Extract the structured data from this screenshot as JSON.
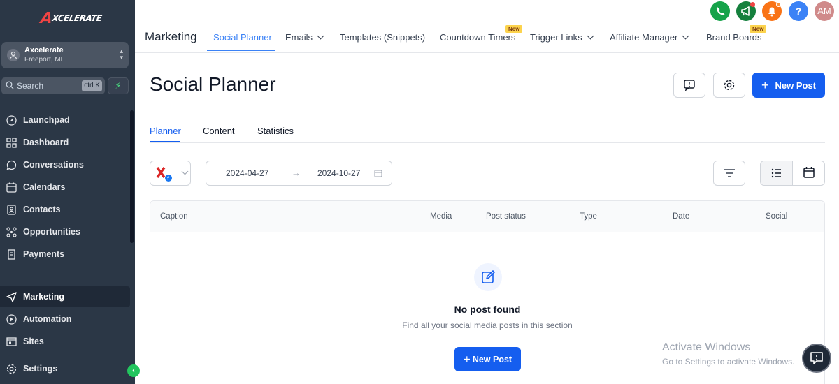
{
  "sidebar": {
    "logo": "XCELERATE",
    "logo_a": "A",
    "account": {
      "name": "Axcelerate",
      "location": "Freeport, ME"
    },
    "search": {
      "placeholder": "Search",
      "shortcut": "ctrl K"
    },
    "nav": [
      {
        "label": "Launchpad",
        "icon": "rocket-icon"
      },
      {
        "label": "Dashboard",
        "icon": "grid-icon"
      },
      {
        "label": "Conversations",
        "icon": "chat-icon"
      },
      {
        "label": "Calendars",
        "icon": "calendar-icon"
      },
      {
        "label": "Contacts",
        "icon": "contacts-icon"
      },
      {
        "label": "Opportunities",
        "icon": "opportunities-icon"
      },
      {
        "label": "Payments",
        "icon": "receipt-icon"
      },
      {
        "label": "Marketing",
        "icon": "send-icon",
        "active": true
      },
      {
        "label": "Automation",
        "icon": "automation-icon"
      },
      {
        "label": "Sites",
        "icon": "sites-icon"
      },
      {
        "label": "Settings",
        "icon": "gear-icon"
      }
    ]
  },
  "topbar": {
    "title": "Marketing",
    "tabs": [
      {
        "label": "Social Planner",
        "active": true
      },
      {
        "label": "Emails",
        "dropdown": true
      },
      {
        "label": "Templates (Snippets)"
      },
      {
        "label": "Countdown Timers",
        "badge": "New"
      },
      {
        "label": "Trigger Links",
        "dropdown": true
      },
      {
        "label": "Affiliate Manager",
        "dropdown": true
      },
      {
        "label": "Brand Boards",
        "badge": "New"
      }
    ],
    "avatar_initials": "AM",
    "help_label": "?",
    "colors": {
      "phone": "#16a34a",
      "megaphone": "#15803d",
      "bell": "#f97316",
      "help": "#3b82f6",
      "avatar": "#d08a8a"
    }
  },
  "page": {
    "title": "Social Planner",
    "new_post_label": "New Post",
    "tabs": [
      "Planner",
      "Content",
      "Statistics"
    ],
    "date_start": "2024-04-27",
    "date_end": "2024-10-27",
    "table": {
      "columns": [
        "Caption",
        "Media",
        "Post status",
        "Type",
        "Date",
        "Social"
      ]
    },
    "empty": {
      "title": "No post found",
      "subtitle": "Find all your social media posts in this section",
      "button_label": "New Post"
    }
  },
  "watermark": {
    "title": "Activate Windows",
    "subtitle": "Go to Settings to activate Windows."
  }
}
